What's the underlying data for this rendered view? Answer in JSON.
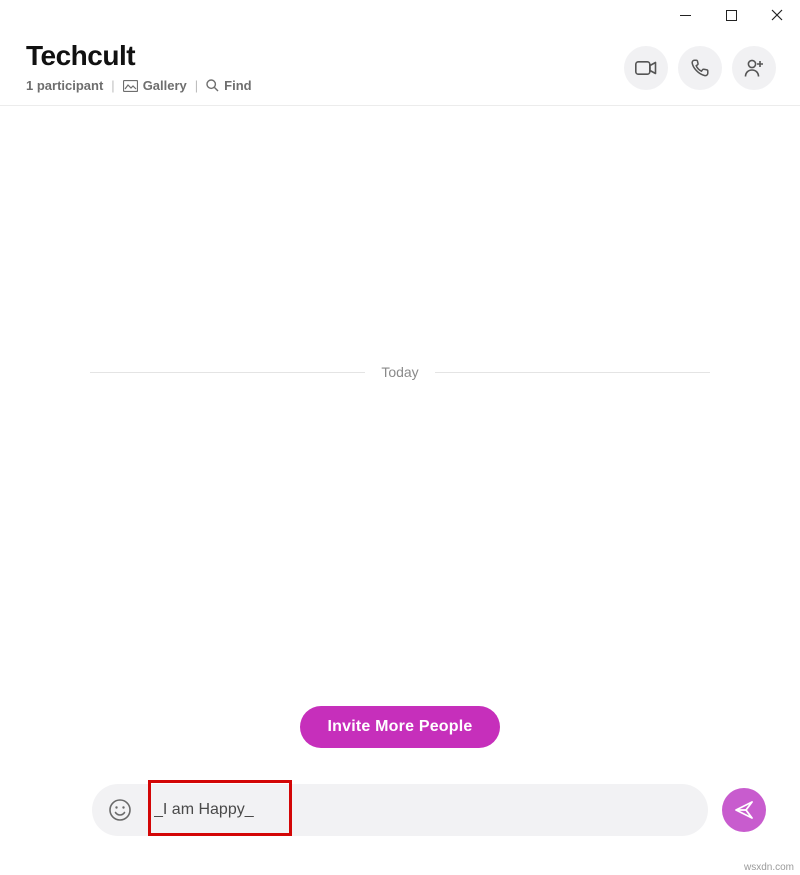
{
  "header": {
    "title": "Techcult",
    "participants": "1 participant",
    "gallery": "Gallery",
    "find": "Find"
  },
  "chat": {
    "date_divider": "Today"
  },
  "invite": {
    "label": "Invite More People"
  },
  "composer": {
    "value": "_I am Happy_"
  },
  "watermark": "wsxdn.com"
}
